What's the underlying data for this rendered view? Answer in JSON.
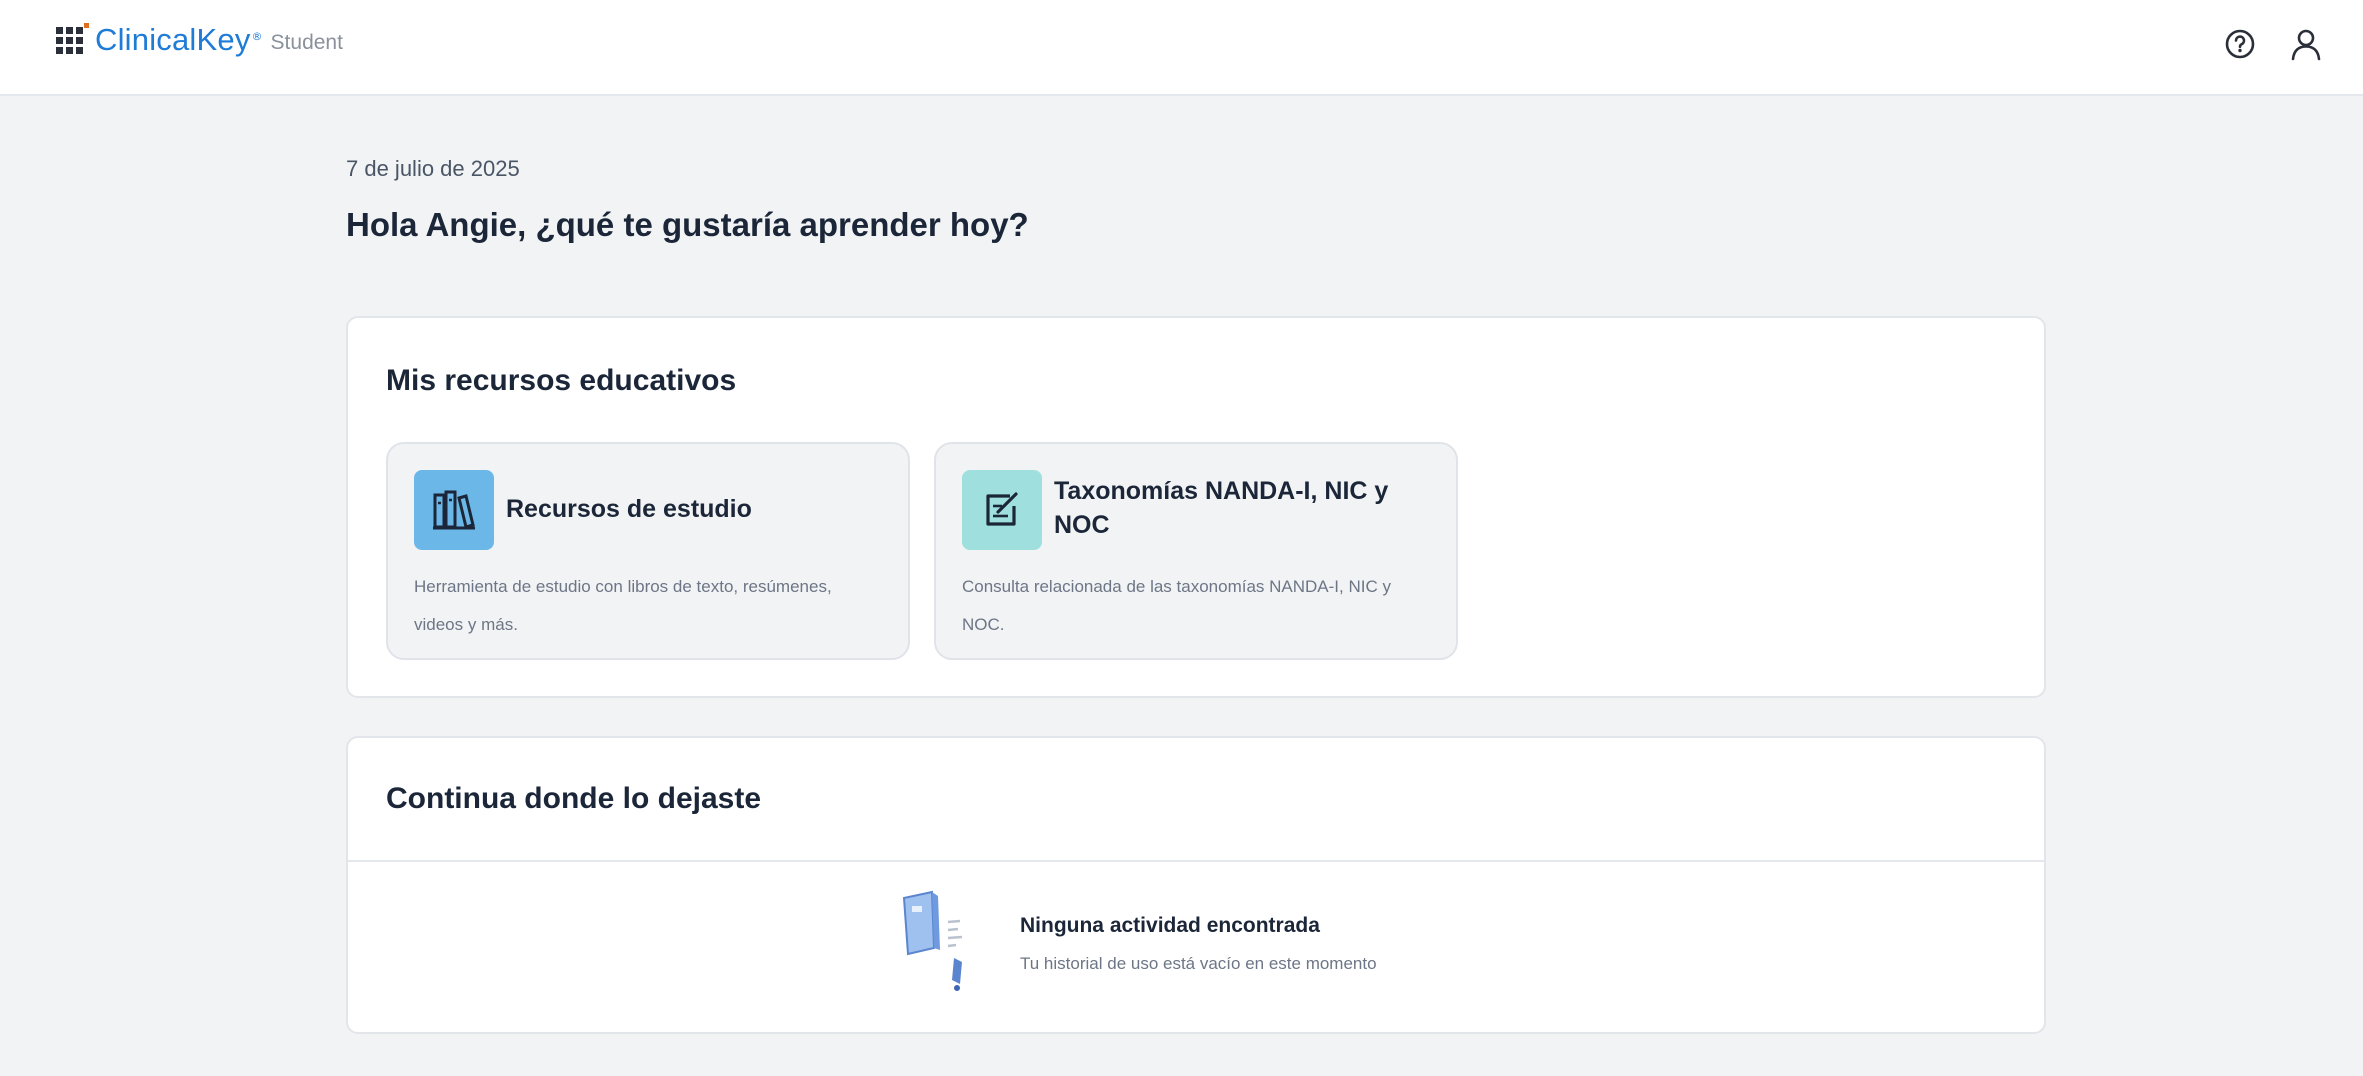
{
  "header": {
    "brand": "ClinicalKey",
    "brand_mark": "®",
    "brand_sub": "Student",
    "icons": [
      "grid-icon",
      "help-icon",
      "user-icon"
    ]
  },
  "greeting": {
    "date": "7 de julio de 2025",
    "title": "Hola Angie, ¿qué te gustaría aprender hoy?"
  },
  "resources": {
    "title": "Mis recursos educativos",
    "cards": [
      {
        "title": "Recursos de estudio",
        "description": "Herramienta de estudio con libros de texto, resúmenes, videos y más.",
        "icon": "books-icon",
        "icon_color": "#6bb7e8"
      },
      {
        "title": "Taxonomías NANDA-I, NIC y NOC",
        "description": "Consulta relacionada de las taxonomías NANDA-I, NIC y NOC.",
        "icon": "edit-checklist-icon",
        "icon_color": "#9fe0de"
      }
    ]
  },
  "continue": {
    "title": "Continua donde lo dejaste",
    "empty_title": "Ninguna actividad encontrada",
    "empty_subtitle": "Tu historial de uso está vacío en este momento",
    "illustration": "empty-book-illustration"
  },
  "colors": {
    "brand_blue": "#1e7bd6",
    "background": "#f1f3f5",
    "text_dark": "#1b2638"
  }
}
